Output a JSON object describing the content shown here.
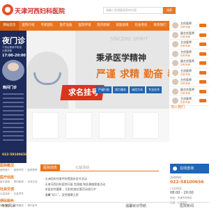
{
  "header": {
    "logo_text": "天津河西妇科医院",
    "search_placeholder": "请输入您想要搜索的内容",
    "search_button": "搜索"
  },
  "nav": {
    "items": [
      "网站首页",
      "医院介绍",
      "专家团队",
      "医疗设备",
      "医院环境",
      "院内新闻",
      "就医指南",
      "社会责任",
      "联系我们"
    ]
  },
  "night": {
    "title": "夜门诊",
    "subtitle": "下班后看病不耽误 无需请假",
    "time": "17:00-20:00",
    "label": "晚间门诊",
    "phone": "022-58100656"
  },
  "banner": {
    "en_text": "SINCERE SPIRIT",
    "badge": "求名挂号",
    "motto": "秉承医学精神",
    "slogans": [
      "严谨",
      "求精",
      "勤奋",
      "奉献"
    ],
    "pills": [
      "严谨行医",
      "倾力服务",
      "诚信为本",
      "专业技术"
    ]
  },
  "experts": {
    "items": [
      {
        "name": "主任医师",
        "title": "妇科专家"
      },
      {
        "name": "副主任医师",
        "title": "妇科专家"
      },
      {
        "name": "主治医师",
        "title": "妇科专家"
      },
      {
        "name": "主任医师",
        "title": "妇科专家"
      },
      {
        "name": "副主任医师",
        "title": "妇科专家"
      },
      {
        "name": "主治医师",
        "title": "妇科专家"
      },
      {
        "name": "主任医师",
        "title": "妇科专家"
      },
      {
        "name": "副主任医师",
        "title": "妇科专家"
      },
      {
        "name": "主治医师",
        "title": "妇科专家"
      }
    ],
    "join": "加入我们"
  },
  "left_sections": [
    {
      "title": "医院概况",
      "sub": "医院简介 ｜ 医院环境 ｜ 医院荣誉"
    },
    {
      "title": "医疗动态",
      "sub": "医疗新闻 ｜ 院内新闻 ｜ 学术交流"
    },
    {
      "title": "社会交流",
      "sub": "公益活动 ｜ 社会责任"
    },
    {
      "title": "便民服务",
      "sub": "就医指南 ｜ 来院路线 ｜ 预约挂号"
    }
  ],
  "tabs": {
    "active": "医院动态",
    "inactive": "公益活动"
  },
  "news": [
    "五洲同庆共度中秋暨国庆佳节活动",
    "天津河西妇科医院开展 宫颈癌 和乳腺癌筛查活动",
    "关爱女性健康 ，妇科检查优惠活动进行中",
    "温馨“初二”，女性健康之家"
  ],
  "online": {
    "head": "在线咨询",
    "phone_label": "咨询热线：",
    "phone": "022-58100656",
    "hours_label": "门诊时间：",
    "hours": "08:00 - 20:00",
    "addr": "地址：天津市河西区",
    "addr2": "交通：公交路线"
  },
  "footer": {
    "left": "专家风采",
    "mid": "温馨就诊导航",
    "right": "医院新闻"
  },
  "colors": {
    "accent": "#e8731f",
    "night": "#1d2a5a",
    "blue": "#1f66b6",
    "red": "#d8341e"
  }
}
